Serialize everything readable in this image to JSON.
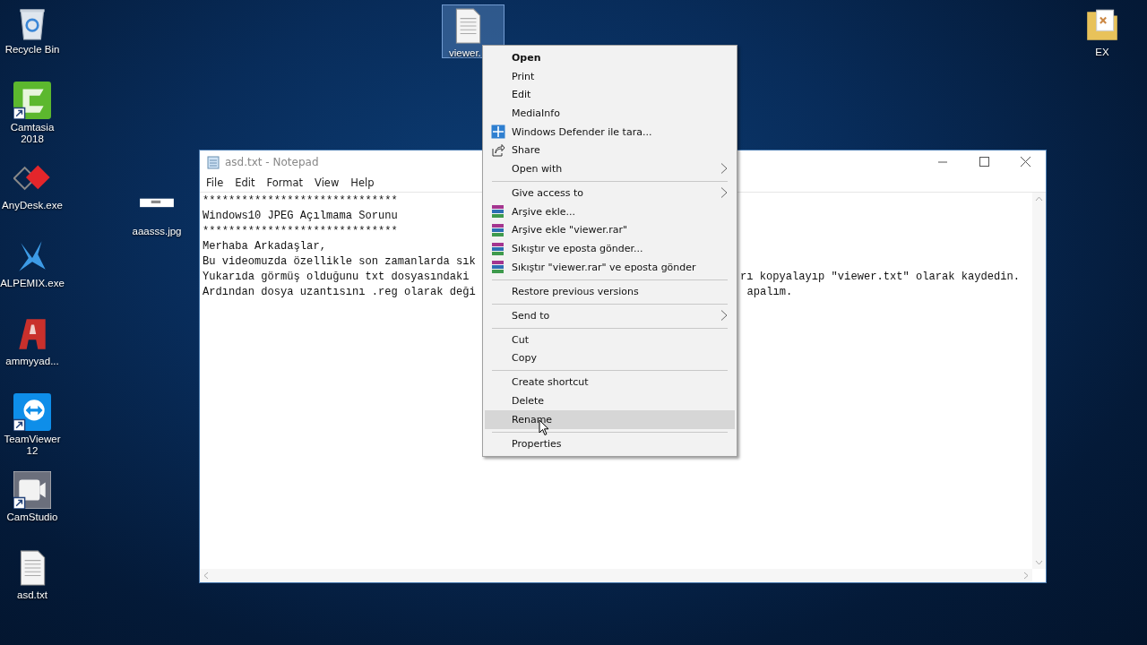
{
  "desktop_left": [
    {
      "kind": "recycle",
      "label": "Recycle Bin",
      "shortcut": false
    },
    {
      "kind": "camtasia",
      "label": "Camtasia 2018",
      "shortcut": true
    },
    {
      "kind": "anydesk",
      "label": "AnyDesk.exe",
      "shortcut": false
    },
    {
      "kind": "alpemix",
      "label": "ALPEMIX.exe",
      "shortcut": false
    },
    {
      "kind": "ammyy",
      "label": "ammyyad...",
      "shortcut": false
    },
    {
      "kind": "teamviewer",
      "label": "TeamViewer 12",
      "shortcut": true
    },
    {
      "kind": "camstudio",
      "label": "CamStudio",
      "shortcut": true
    },
    {
      "kind": "textfile",
      "label": "asd.txt",
      "shortcut": false
    }
  ],
  "desktop_other": [
    {
      "kind": "image",
      "label": "aaasss.jpg",
      "selected": false
    },
    {
      "kind": "textfile",
      "label": "viewer.",
      "selected": true
    },
    {
      "kind": "folder",
      "label": "EX",
      "selected": false
    }
  ],
  "notepad": {
    "title": "asd.txt - Notepad",
    "menu": [
      "File",
      "Edit",
      "Format",
      "View",
      "Help"
    ],
    "lines": [
      {
        "left": "******************************"
      },
      {
        "left": "Windows10 JPEG Açılmama Sorunu"
      },
      {
        "left": "******************************"
      },
      {
        "left": "Merhaba Arkadaşlar,"
      },
      {
        "left": "Bu videomuzda özellikle son zamanlarda sık"
      },
      {
        "left": "Yukarıda görmüş olduğunu txt dosyasındaki",
        "right": "rı kopyalayıp \"viewer.txt\" olarak kaydedin."
      },
      {
        "left": "Ardından dosya uzantısını .reg olarak deği",
        "right": "apalım."
      }
    ]
  },
  "context_menu": [
    {
      "kind": "plain",
      "label": "Open",
      "default": true,
      "submenu": false,
      "selected": false
    },
    {
      "kind": "plain",
      "label": "Print",
      "default": false,
      "submenu": false,
      "selected": false
    },
    {
      "kind": "plain",
      "label": "Edit",
      "default": false,
      "submenu": false,
      "selected": false
    },
    {
      "kind": "plain",
      "label": "MediaInfo",
      "default": false,
      "submenu": false,
      "selected": false
    },
    {
      "kind": "defender",
      "label": "Windows Defender ile tara...",
      "default": false,
      "submenu": false,
      "selected": false
    },
    {
      "kind": "share",
      "label": "Share",
      "default": false,
      "submenu": false,
      "selected": false
    },
    {
      "kind": "plain",
      "label": "Open with",
      "default": false,
      "submenu": true,
      "selected": false
    },
    {
      "kind": "separator"
    },
    {
      "kind": "plain",
      "label": "Give access to",
      "default": false,
      "submenu": true,
      "selected": false
    },
    {
      "kind": "archive",
      "label": "Arşive ekle...",
      "default": false,
      "submenu": false,
      "selected": false
    },
    {
      "kind": "archive",
      "label": "Arşive ekle \"viewer.rar\"",
      "default": false,
      "submenu": false,
      "selected": false
    },
    {
      "kind": "archive",
      "label": "Sıkıştır ve eposta gönder...",
      "default": false,
      "submenu": false,
      "selected": false
    },
    {
      "kind": "archive",
      "label": "Sıkıştır \"viewer.rar\" ve eposta gönder",
      "default": false,
      "submenu": false,
      "selected": false
    },
    {
      "kind": "separator"
    },
    {
      "kind": "plain",
      "label": "Restore previous versions",
      "default": false,
      "submenu": false,
      "selected": false
    },
    {
      "kind": "separator"
    },
    {
      "kind": "plain",
      "label": "Send to",
      "default": false,
      "submenu": true,
      "selected": false
    },
    {
      "kind": "separator"
    },
    {
      "kind": "plain",
      "label": "Cut",
      "default": false,
      "submenu": false,
      "selected": false
    },
    {
      "kind": "plain",
      "label": "Copy",
      "default": false,
      "submenu": false,
      "selected": false
    },
    {
      "kind": "separator"
    },
    {
      "kind": "plain",
      "label": "Create shortcut",
      "default": false,
      "submenu": false,
      "selected": false
    },
    {
      "kind": "plain",
      "label": "Delete",
      "default": false,
      "submenu": false,
      "selected": false
    },
    {
      "kind": "plain",
      "label": "Rename",
      "default": false,
      "submenu": false,
      "selected": true
    },
    {
      "kind": "separator"
    },
    {
      "kind": "plain",
      "label": "Properties",
      "default": false,
      "submenu": false,
      "selected": false
    }
  ]
}
